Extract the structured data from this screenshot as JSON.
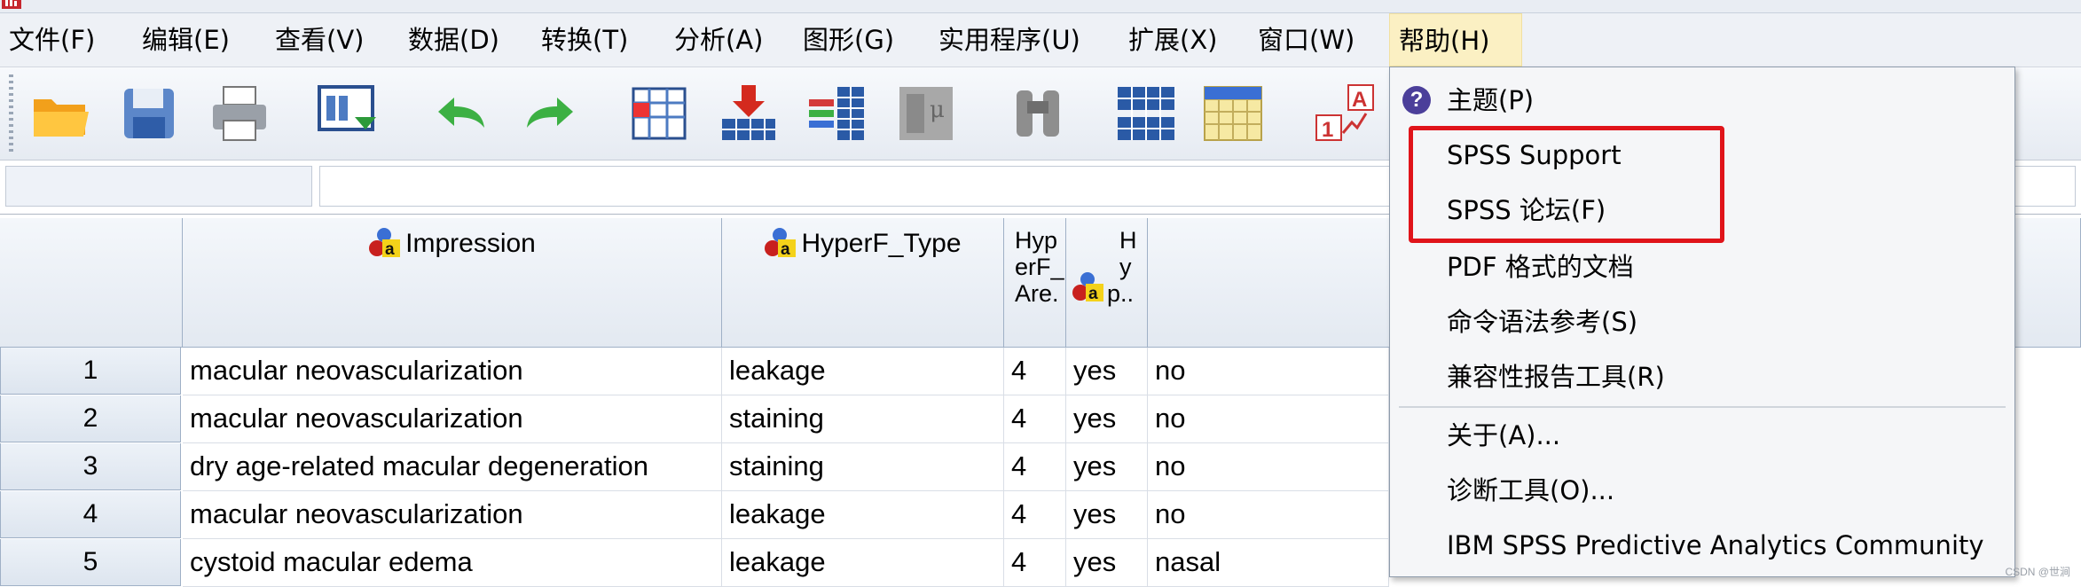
{
  "menubar": {
    "items": [
      {
        "label": "文件(F)"
      },
      {
        "label": "编辑(E)"
      },
      {
        "label": "查看(V)"
      },
      {
        "label": "数据(D)"
      },
      {
        "label": "转换(T)"
      },
      {
        "label": "分析(A)"
      },
      {
        "label": "图形(G)"
      },
      {
        "label": "实用程序(U)"
      },
      {
        "label": "扩展(X)"
      },
      {
        "label": "窗口(W)"
      },
      {
        "label": "帮助(H)"
      }
    ],
    "active_item": "帮助(H)"
  },
  "toolbar": {
    "icons": [
      "open-folder-icon",
      "save-icon",
      "print-icon",
      "recall-dialog-icon",
      "undo-icon",
      "redo-icon",
      "goto-case-icon",
      "goto-variable-icon",
      "variables-icon",
      "descriptive-stats-icon",
      "find-icon",
      "insert-cases-icon",
      "insert-variable-icon",
      "value-labels-icon"
    ]
  },
  "grid": {
    "columns": [
      {
        "name": "Impression",
        "icon": "nominal-string-icon"
      },
      {
        "name": "HyperF_Type",
        "icon": "nominal-string-icon"
      },
      {
        "lines": [
          "Hyp",
          "erF_",
          "Are."
        ]
      },
      {
        "icon": "nominal-string-icon",
        "lines": [
          "H",
          "y",
          "p.."
        ]
      }
    ],
    "rows": [
      {
        "num": "1",
        "impression": "macular neovascularization",
        "type": "leakage",
        "area": "4",
        "c4": "yes",
        "c5": "no"
      },
      {
        "num": "2",
        "impression": "macular neovascularization",
        "type": "staining",
        "area": "4",
        "c4": "yes",
        "c5": "no"
      },
      {
        "num": "3",
        "impression": "dry age-related macular degeneration",
        "type": "staining",
        "area": "4",
        "c4": "yes",
        "c5": "no"
      },
      {
        "num": "4",
        "impression": "macular neovascularization",
        "type": "leakage",
        "area": "4",
        "c4": "yes",
        "c5": "no"
      },
      {
        "num": "5",
        "impression": "cystoid macular edema",
        "type": "leakage",
        "area": "4",
        "c4": "yes",
        "c5": "nasal"
      }
    ]
  },
  "help_menu": {
    "items": [
      {
        "label": "主题(P)",
        "icon": "help-topics-icon"
      },
      {
        "label": "SPSS Support"
      },
      {
        "label": "SPSS 论坛(F)"
      },
      {
        "label": "PDF 格式的文档"
      },
      {
        "label": "命令语法参考(S)"
      },
      {
        "label": "兼容性报告工具(R)"
      },
      {
        "label": "关于(A)..."
      },
      {
        "label": "诊断工具(O)..."
      },
      {
        "label": "IBM SPSS Predictive Analytics Community"
      }
    ]
  },
  "annotation": {
    "color": "#e0141a"
  },
  "watermark": "CSDN @世涧",
  "colors": {
    "menubar_bg": "#eef1f6",
    "active_menu_bg": "#fbf0c3",
    "header_bg": "#e3e9f1"
  }
}
